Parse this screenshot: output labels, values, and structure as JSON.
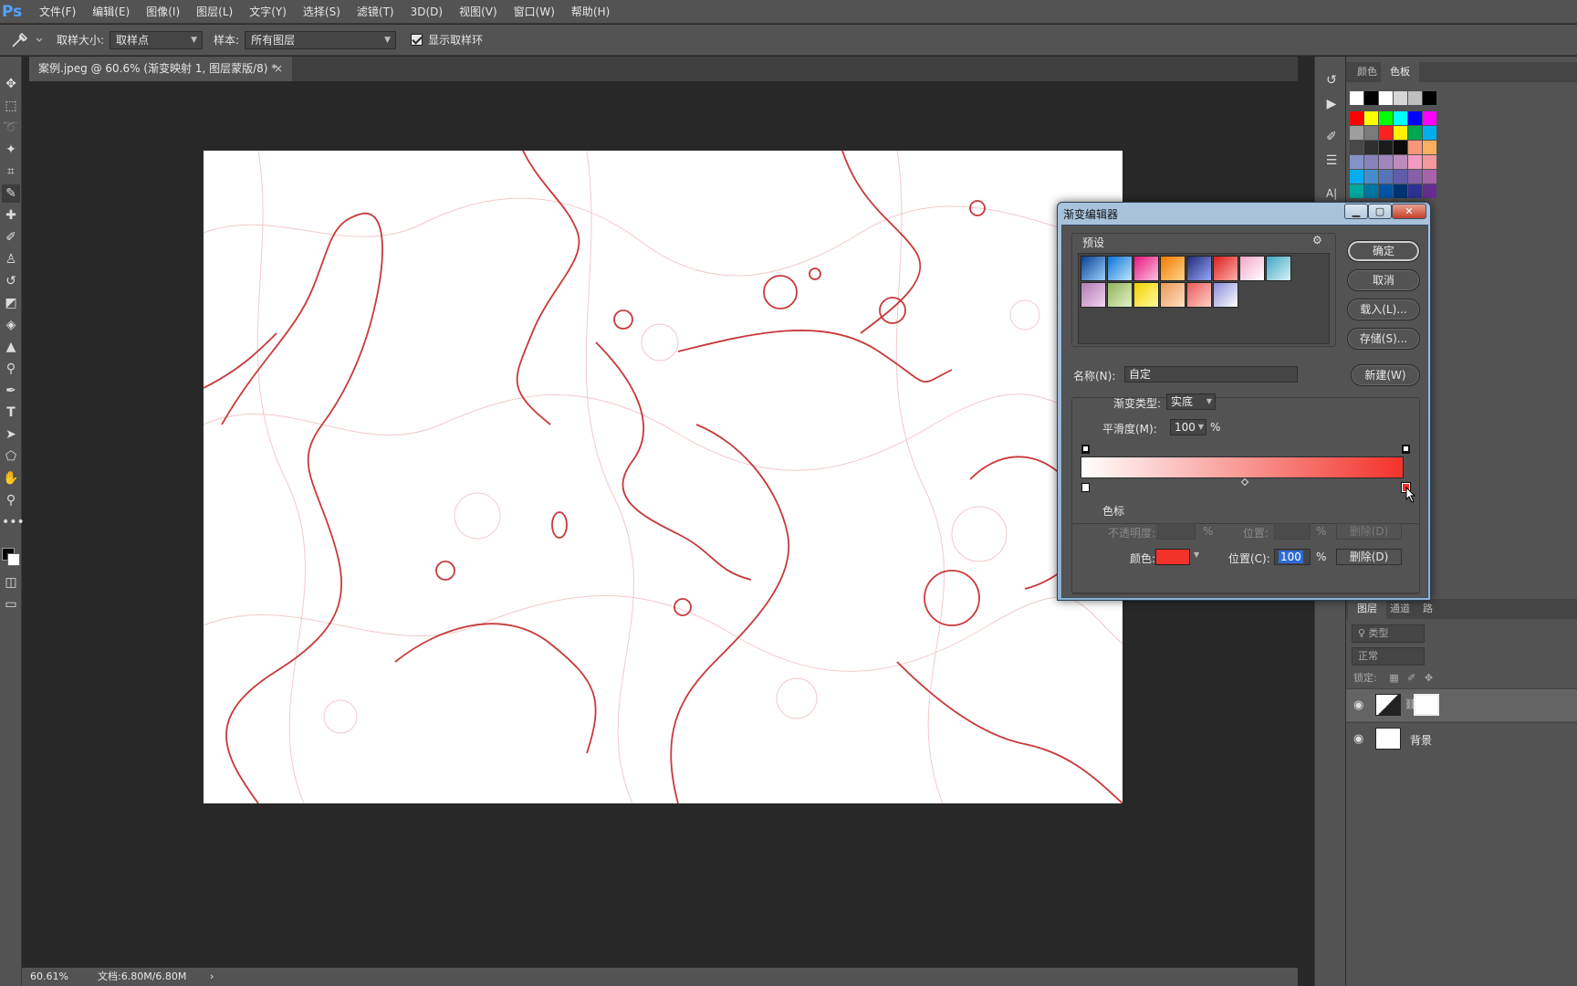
{
  "app": {
    "logo": "Ps",
    "menu": [
      "文件(F)",
      "编辑(E)",
      "图像(I)",
      "图层(L)",
      "文字(Y)",
      "选择(S)",
      "滤镜(T)",
      "3D(D)",
      "视图(V)",
      "窗口(W)",
      "帮助(H)"
    ]
  },
  "options": {
    "sample_size_label": "取样大小:",
    "sample_size_value": "取样点",
    "sample_label": "样本:",
    "sample_value": "所有图层",
    "show_ring_label": "显示取样环",
    "show_ring_checked": true
  },
  "document": {
    "tab_title": "案例.jpeg @ 60.6% (渐变映射 1, 图层蒙版/8) *",
    "close_glyph": "×"
  },
  "status": {
    "zoom": "60.61%",
    "doc_size": "文档:6.80M/6.80M",
    "arrow": "›"
  },
  "panels": {
    "tab_color": "颜色",
    "tab_swatches": "色板",
    "layers_tab_1": "图层",
    "layers_tab_2": "通道",
    "layers_tab_3": "路",
    "filter_placeholder": "♀ 类型",
    "blend_mode": "正常",
    "lock_label": "锁定:",
    "layer_background": "背景"
  },
  "swatches": {
    "row1": [
      "#ffffff",
      "#000000",
      "#ffffff",
      "#d6d6d6",
      "#bfbfbf",
      "#000000"
    ],
    "row2": [
      "#ff0000",
      "#ffff00",
      "#00ff00",
      "#00ffff",
      "#0000ff",
      "#ff00ff"
    ],
    "row3": [
      "#9e9e9e",
      "#7a7a7a",
      "#ff2020",
      "#ffef00",
      "#00a651",
      "#00aeef"
    ],
    "row4": [
      "#474747",
      "#2f2f2f",
      "#1c1c1c",
      "#0a0a0a",
      "#f7977a",
      "#fbaf5d"
    ],
    "row5": [
      "#8393ca",
      "#8781bd",
      "#a186be",
      "#bd8cbf",
      "#f49ac1",
      "#f5989d"
    ],
    "row6": [
      "#00aeef",
      "#448ccb",
      "#5674b9",
      "#605ca8",
      "#855fa8",
      "#a864a8"
    ],
    "row7": [
      "#00a99d",
      "#0076a3",
      "#0054a6",
      "#003471",
      "#2e3192",
      "#662d91"
    ]
  },
  "dialog": {
    "title": "渐变编辑器",
    "presets_label": "预设",
    "gear": "⚙",
    "buttons": {
      "ok": "确定",
      "cancel": "取消",
      "load": "载入(L)...",
      "save": "存储(S)...",
      "new": "新建(W)"
    },
    "name_label": "名称(N):",
    "name_value": "自定",
    "type_label": "渐变类型:",
    "type_value": "实底",
    "smooth_label": "平滑度(M):",
    "smooth_value": "100",
    "percent": "%",
    "stops_label": "色标",
    "opacity_label": "不透明度:",
    "location_label_top": "位置:",
    "delete_label": "删除(D)",
    "color_label": "颜色:",
    "location_label": "位置(C):",
    "location_value": "100",
    "gradient_start": "#ffffff",
    "gradient_end": "#f3322a",
    "presets_row1": [
      [
        "#0a3f8f",
        "#9bd1ff"
      ],
      [
        "#0b72d6",
        "#bfe7ff"
      ],
      [
        "#e2187f",
        "#ffc0e2"
      ],
      [
        "#f07b00",
        "#ffd48a"
      ],
      [
        "#1e2a6f",
        "#9aa6ff"
      ],
      [
        "#d81f1f",
        "#ffb0a8"
      ],
      [
        "#f4a7c8",
        "#ffffff"
      ],
      [
        "#3fa6c3",
        "#d6f2f7"
      ]
    ],
    "presets_row2": [
      [
        "#b07ab4",
        "#f3d6f2"
      ],
      [
        "#8fb35a",
        "#e4f2c8"
      ],
      [
        "#f3d000",
        "#fffca0"
      ],
      [
        "#e89a5a",
        "#ffe0c0"
      ],
      [
        "#e85a5a",
        "#ffd0c8"
      ],
      [
        "#8a8ad8",
        "#ffffff"
      ]
    ]
  }
}
